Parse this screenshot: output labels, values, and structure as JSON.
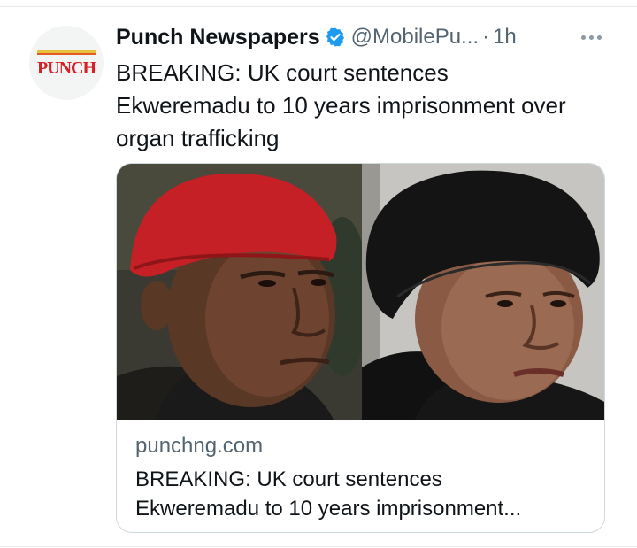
{
  "tweet": {
    "author": {
      "display_name": "Punch Newspapers",
      "handle": "@MobilePu...",
      "separator": "·",
      "timestamp": "1h",
      "verified": true,
      "avatar_logo_text": "PUNCH",
      "avatar_icon": "punch-logo"
    },
    "text_line1": "BREAKING: UK court sentences",
    "text_line2": "Ekweremadu to 10 years imprisonment over",
    "text_line3": "organ trafficking",
    "more_icon": "more-horizontal-icon"
  },
  "link_card": {
    "domain": "punchng.com",
    "title_line1": "BREAKING: UK court sentences",
    "title_line2": "Ekweremadu to 10 years imprisonment..."
  },
  "colors": {
    "verified_blue": "#1d9bf0",
    "secondary_text": "#536471",
    "punch_red": "#d71f26",
    "border": "#cfd9de"
  }
}
